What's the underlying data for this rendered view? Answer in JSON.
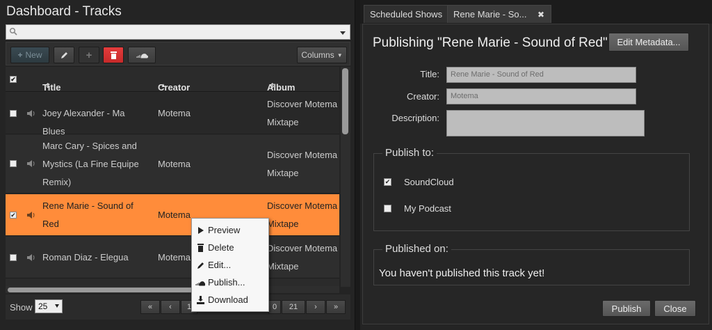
{
  "dashboard": {
    "title": "Dashboard - Tracks",
    "toolbar": {
      "new_label": "New",
      "columns_label": "Columns"
    },
    "columns": {
      "title": "Title",
      "creator": "Creator",
      "album": "Album"
    },
    "rows": [
      {
        "title": "Joey Alexander - Ma Blues",
        "creator": "Motema",
        "album": "Discover Motema Mixtape",
        "album_line1": "Discover Motema I",
        "album_line2": "Mixtape",
        "checked": false,
        "selected": false
      },
      {
        "title": "Marc Cary - Spices and Mystics (La Fine Equipe Remix)",
        "title_line1": "Marc Cary - Spices and",
        "title_line2": "Mystics (La Fine Equipe",
        "title_line3": "Remix)",
        "creator": "Motema",
        "album_line1": "Discover Motema I",
        "album_line2": "Mixtape",
        "checked": false,
        "selected": false
      },
      {
        "title_line1": "Rene Marie - Sound of",
        "title_line2": "Red",
        "creator": "Motema",
        "album_line1": "Discover Motema I",
        "album_line2": "Mixtape",
        "checked": true,
        "selected": true
      },
      {
        "title": "Roman Diaz - Elegua",
        "creator": "Motema",
        "album_line1": "Discover Motema I",
        "album_line2": "Mixtape",
        "checked": false,
        "selected": false
      }
    ],
    "footer": {
      "show_label": "Show",
      "page_size": "25",
      "pager": {
        "first": "«",
        "prev": "‹",
        "page_partial": "1",
        "page_partial2": "0",
        "last_page": "21",
        "next": "›",
        "last": "»"
      }
    },
    "context_menu": [
      {
        "label": "Preview",
        "icon": "play-icon"
      },
      {
        "label": "Delete",
        "icon": "trash-icon"
      },
      {
        "label": "Edit...",
        "icon": "pencil-icon"
      },
      {
        "label": "Publish...",
        "icon": "soundcloud-icon"
      },
      {
        "label": "Download",
        "icon": "download-icon"
      }
    ]
  },
  "publish": {
    "tabs": [
      {
        "label": "Scheduled Shows"
      },
      {
        "label": "Rene Marie - So..."
      }
    ],
    "close_tab_glyph": "✖",
    "heading": "Publishing \"Rene Marie - Sound of Red\"",
    "edit_metadata_label": "Edit Metadata...",
    "form": {
      "title_label": "Title:",
      "title_value": "Rene Marie - Sound of Red",
      "creator_label": "Creator:",
      "creator_value": "Motema",
      "description_label": "Description:",
      "description_value": ""
    },
    "publish_to": {
      "legend": "Publish to:",
      "options": [
        {
          "label": "SoundCloud",
          "checked": true
        },
        {
          "label": "My Podcast",
          "checked": false
        }
      ]
    },
    "published_on": {
      "legend": "Published on:",
      "message": "You haven't published this track yet!"
    },
    "buttons": {
      "publish": "Publish",
      "close": "Close"
    }
  },
  "colors": {
    "selected_row": "#ff8c3a",
    "delete_button": "#d63030",
    "background": "#242424"
  }
}
